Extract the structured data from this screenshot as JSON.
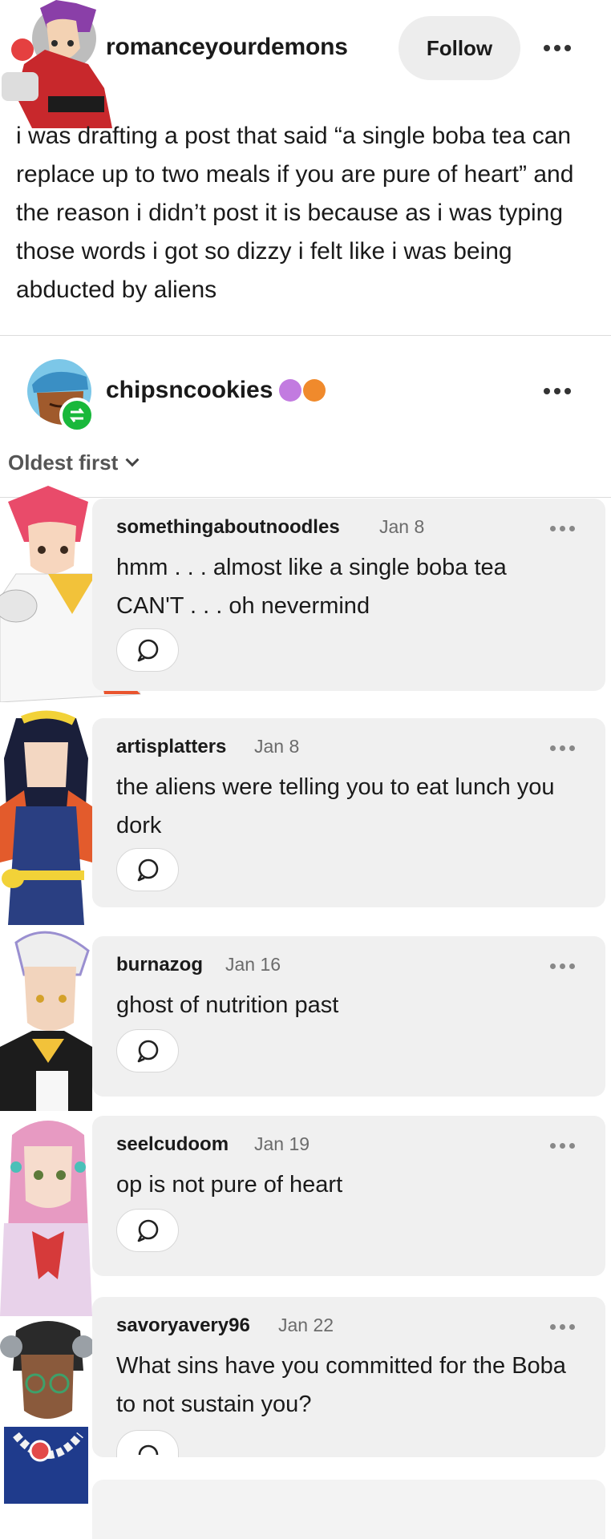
{
  "post": {
    "author": "romanceyourdemons",
    "follow_label": "Follow",
    "text": "i was drafting a post that said “a single boba tea can replace up to two meals if you are pure of heart” and the reason i didn’t post it is because as i was typing those words i got so dizzy i felt like i was being abducted by aliens"
  },
  "reblogger": {
    "username": "chipsncookies",
    "badge_colors": [
      "#c27be0",
      "#f08a2c"
    ]
  },
  "replies_sort": {
    "label": "Oldest first"
  },
  "replies": [
    {
      "username": "somethingaboutnoodles",
      "date": "Jan 8",
      "text": "hmm . . . almost like a single boba tea CAN'T . . . oh nevermind"
    },
    {
      "username": "artisplatters",
      "date": "Jan 8",
      "text": "the aliens were telling you to eat lunch you dork"
    },
    {
      "username": "burnazog",
      "date": "Jan 16",
      "text": "ghost of nutrition past"
    },
    {
      "username": "seelcudoom",
      "date": "Jan 19",
      "text": "op is not pure of heart"
    },
    {
      "username": "savoryavery96",
      "date": "Jan 22",
      "text": "What sins have you committed for the Boba to not sustain you?"
    }
  ],
  "icons": {
    "more": "more-options-icon",
    "reblog": "reblog-icon",
    "reply": "reply-bubble-icon",
    "chevron": "chevron-down-icon"
  },
  "colors": {
    "reblog_badge": "#19b83b",
    "card_bg": "#f0f0f0",
    "follow_bg": "#ededed"
  }
}
